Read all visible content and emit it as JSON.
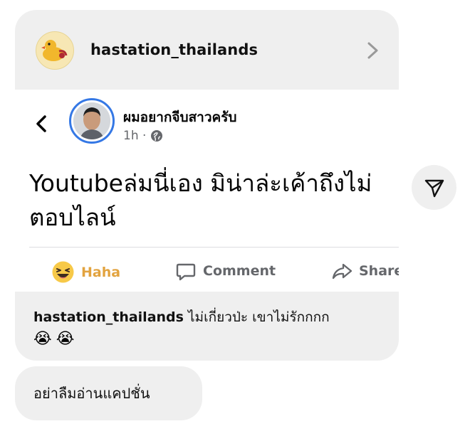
{
  "shared_post": {
    "account_name": "hastation_thailands",
    "post": {
      "author": "ผมอยากจีบสาวครับ",
      "time": "1h ·",
      "text": "Youtubeล่มนี่เอง มิน่าล่ะเค้าถึงไม่ตอบไลน์",
      "actions": {
        "haha": "Haha",
        "comment": "Comment",
        "share": "Share"
      }
    },
    "caption": {
      "user": "hastation_thailands",
      "text": " ไม่เกี่ยวป่ะ เขาไม่รักกกก",
      "emojis": [
        "😭",
        "😭"
      ]
    }
  },
  "message": {
    "text": "อย่าลืมอ่านแคปชั่น"
  },
  "colors": {
    "bubble": "#efefef",
    "haha_accent": "#e2a33f",
    "avatar_ring": "#3578e5"
  },
  "icons": [
    "chevron-right-icon",
    "chevron-left-icon",
    "globe-icon",
    "haha-reaction-icon",
    "comment-icon",
    "share-icon",
    "send-icon"
  ]
}
